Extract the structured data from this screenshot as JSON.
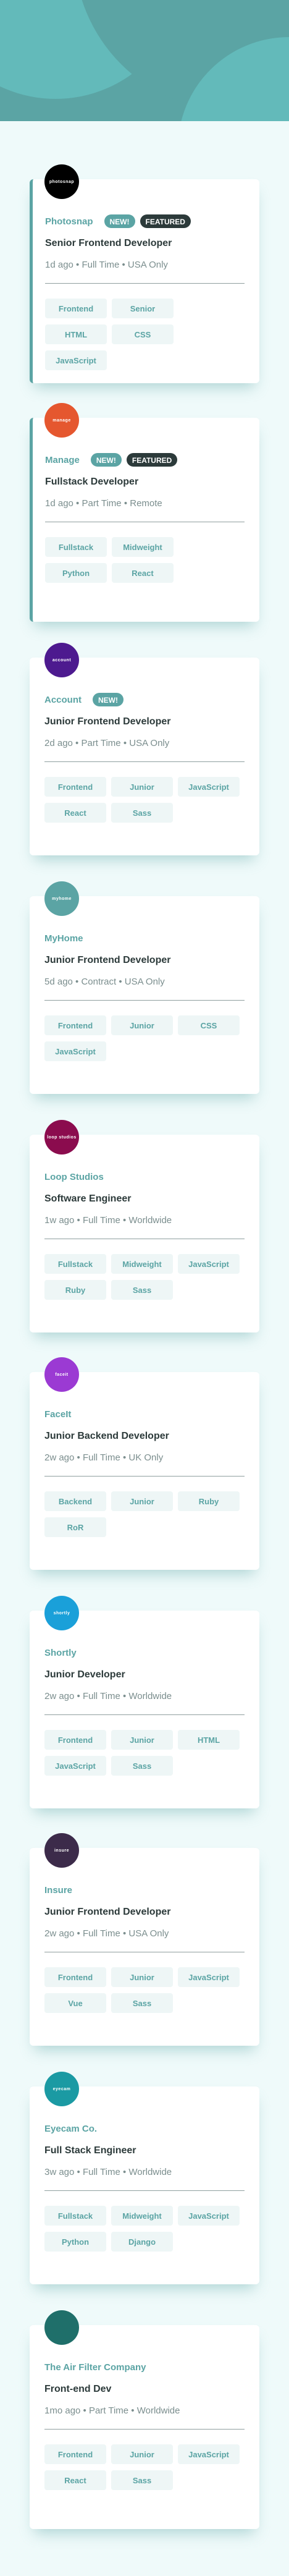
{
  "jobs": [
    {
      "company": "Photosnap",
      "logo_text": "photosnap",
      "logo_color": "#000000",
      "new": true,
      "featured": true,
      "position": "Senior Frontend Developer",
      "meta": "1d ago • Full Time • USA Only",
      "tags": [
        "Frontend",
        "Senior",
        "HTML",
        "CSS",
        "JavaScript"
      ]
    },
    {
      "company": "Manage",
      "logo_text": "manage",
      "logo_color": "#e5572f",
      "new": true,
      "featured": true,
      "position": "Fullstack Developer",
      "meta": "1d ago • Part Time • Remote",
      "tags": [
        "Fullstack",
        "Midweight",
        "Python",
        "React"
      ]
    },
    {
      "company": "Account",
      "logo_text": "account",
      "logo_color": "#4d1a8f",
      "new": true,
      "featured": false,
      "position": "Junior Frontend Developer",
      "meta": "2d ago • Part Time • USA Only",
      "tags": [
        "Frontend",
        "Junior",
        "JavaScript",
        "React",
        "Sass"
      ]
    },
    {
      "company": "MyHome",
      "logo_text": "myhome",
      "logo_color": "#5ba4a4",
      "new": false,
      "featured": false,
      "position": "Junior Frontend Developer",
      "meta": "5d ago • Contract • USA Only",
      "tags": [
        "Frontend",
        "Junior",
        "CSS",
        "JavaScript"
      ]
    },
    {
      "company": "Loop Studios",
      "logo_text": "loop studios",
      "logo_color": "#8b0c4e",
      "new": false,
      "featured": false,
      "position": "Software Engineer",
      "meta": "1w ago • Full Time • Worldwide",
      "tags": [
        "Fullstack",
        "Midweight",
        "JavaScript",
        "Ruby",
        "Sass"
      ]
    },
    {
      "company": "FaceIt",
      "logo_text": "faceit",
      "logo_color": "#9b3ad3",
      "new": false,
      "featured": false,
      "position": "Junior Backend Developer",
      "meta": "2w ago • Full Time • UK Only",
      "tags": [
        "Backend",
        "Junior",
        "Ruby",
        "RoR"
      ]
    },
    {
      "company": "Shortly",
      "logo_text": "shortly",
      "logo_color": "#1aa0d9",
      "new": false,
      "featured": false,
      "position": "Junior Developer",
      "meta": "2w ago • Full Time • Worldwide",
      "tags": [
        "Frontend",
        "Junior",
        "HTML",
        "JavaScript",
        "Sass"
      ]
    },
    {
      "company": "Insure",
      "logo_text": "insure",
      "logo_color": "#3c2b4a",
      "new": false,
      "featured": false,
      "position": "Junior Frontend Developer",
      "meta": "2w ago • Full Time • USA Only",
      "tags": [
        "Frontend",
        "Junior",
        "JavaScript",
        "Vue",
        "Sass"
      ]
    },
    {
      "company": "Eyecam Co.",
      "logo_text": "eyecam",
      "logo_color": "#1b9aa3",
      "new": false,
      "featured": false,
      "position": "Full Stack Engineer",
      "meta": "3w ago • Full Time • Worldwide",
      "tags": [
        "Fullstack",
        "Midweight",
        "JavaScript",
        "Python",
        "Django"
      ]
    },
    {
      "company": "The Air Filter Company",
      "logo_text": "",
      "logo_color": "#1f6f6a",
      "new": false,
      "featured": false,
      "position": "Front-end Dev",
      "meta": "1mo ago • Part Time • Worldwide",
      "tags": [
        "Frontend",
        "Junior",
        "JavaScript",
        "React",
        "Sass"
      ]
    }
  ],
  "labels": {
    "new_badge": "NEW!",
    "featured_badge": "FEATURED"
  }
}
